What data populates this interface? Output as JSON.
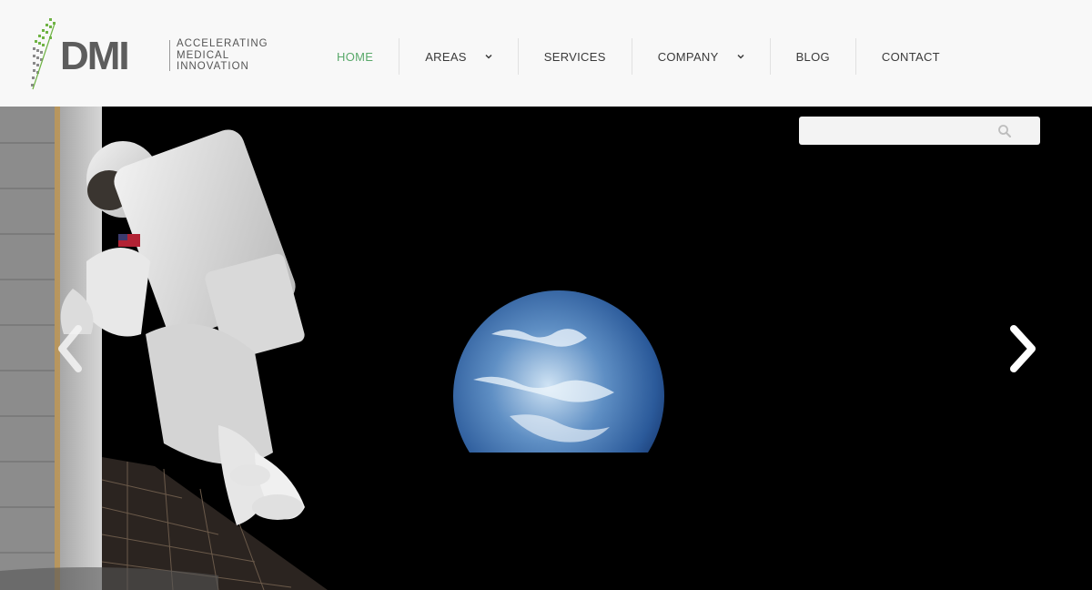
{
  "brand": {
    "wordmark": "DMI",
    "tagline": [
      "ACCELERATING",
      "MEDICAL",
      "INNOVATION"
    ],
    "accent_color": "#5aa96b"
  },
  "nav": {
    "items": [
      {
        "label": "HOME",
        "active": true,
        "dropdown": false
      },
      {
        "label": "AREAS",
        "active": false,
        "dropdown": true
      },
      {
        "label": "SERVICES",
        "active": false,
        "dropdown": false
      },
      {
        "label": "COMPANY",
        "active": false,
        "dropdown": true
      },
      {
        "label": "BLOG",
        "active": false,
        "dropdown": false
      },
      {
        "label": "CONTACT",
        "active": false,
        "dropdown": false
      }
    ]
  },
  "search": {
    "value": "",
    "placeholder": "",
    "icon": "search-icon"
  },
  "carousel": {
    "prev_icon": "chevron-left-icon",
    "next_icon": "chevron-right-icon"
  }
}
